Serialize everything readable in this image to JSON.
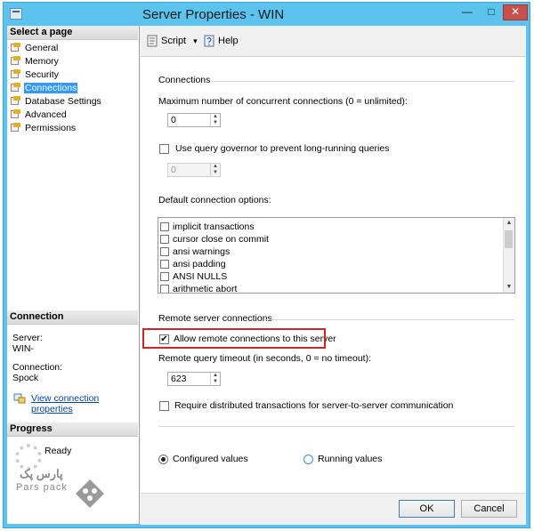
{
  "window": {
    "title": "Server Properties - WIN",
    "min_glyph": "—",
    "max_glyph": "□",
    "close_glyph": "✕"
  },
  "left_pane": {
    "select_page_header": "Select a page",
    "nav_items": [
      {
        "label": "General",
        "icon": "page-wrench-icon",
        "selected": false
      },
      {
        "label": "Memory",
        "icon": "page-wrench-icon",
        "selected": false
      },
      {
        "label": "Security",
        "icon": "page-wrench-icon",
        "selected": false
      },
      {
        "label": "Connections",
        "icon": "page-wrench-icon",
        "selected": true
      },
      {
        "label": "Database Settings",
        "icon": "page-wrench-icon",
        "selected": false
      },
      {
        "label": "Advanced",
        "icon": "page-wrench-icon",
        "selected": false
      },
      {
        "label": "Permissions",
        "icon": "page-wrench-icon",
        "selected": false
      }
    ],
    "connection_header": "Connection",
    "server_label": "Server:",
    "server_value": "WIN-",
    "connection_label": "Connection:",
    "connection_value": "Spock",
    "view_link": "View connection properties",
    "progress_header": "Progress",
    "progress_status": "Ready"
  },
  "toolbar": {
    "script_label": "Script",
    "script_dropdown_glyph": "▾",
    "help_label": "Help"
  },
  "connections": {
    "section_title": "Connections",
    "max_conn_label": "Maximum number of concurrent connections (0 = unlimited):",
    "max_conn_value": "0",
    "query_governor_label": "Use query governor to prevent long-running queries",
    "query_governor_checked": false,
    "query_governor_value": "0",
    "default_options_label": "Default connection options:",
    "default_options": [
      {
        "label": "implicit transactions",
        "checked": false
      },
      {
        "label": "cursor close on commit",
        "checked": false
      },
      {
        "label": "ansi warnings",
        "checked": false
      },
      {
        "label": "ansi padding",
        "checked": false
      },
      {
        "label": "ANSI NULLS",
        "checked": false
      },
      {
        "label": "arithmetic abort",
        "checked": false
      }
    ]
  },
  "remote": {
    "section_title": "Remote server connections",
    "allow_remote_label": "Allow remote connections to this server",
    "allow_remote_checked": true,
    "check_glyph": "✔",
    "timeout_label": "Remote query timeout (in seconds, 0 = no timeout):",
    "timeout_value": "623",
    "require_distributed_label": "Require distributed transactions for server-to-server communication",
    "require_distributed_checked": false
  },
  "values_mode": {
    "configured_label": "Configured values",
    "running_label": "Running values",
    "selected": "configured"
  },
  "buttons": {
    "ok_label": "OK",
    "cancel_label": "Cancel"
  },
  "watermark": {
    "text_fa": "پارس پک",
    "text_en": "Pars pack"
  },
  "colors": {
    "selection": "#3399ff",
    "highlight_box": "#c8282a",
    "title_bar": "#5cc2ee",
    "link": "#0645ad"
  }
}
